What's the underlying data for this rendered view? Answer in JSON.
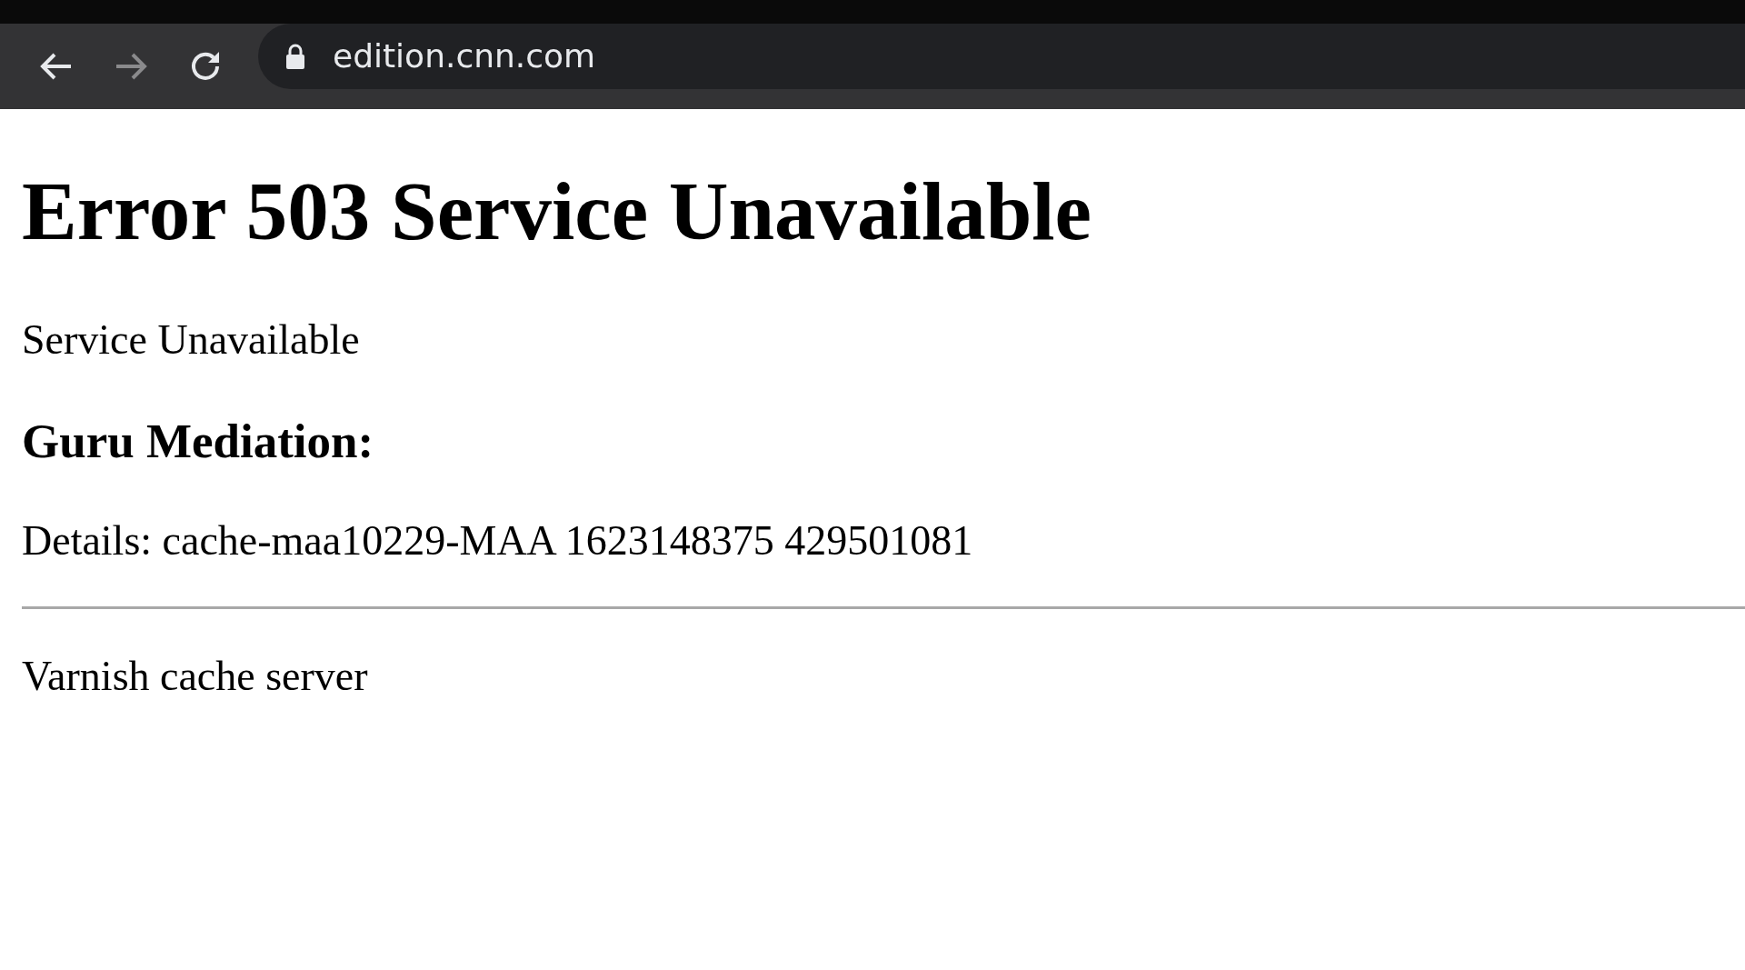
{
  "browser": {
    "nav_buttons": [
      {
        "kind": "back",
        "disabled": false
      },
      {
        "kind": "forward",
        "disabled": true
      },
      {
        "kind": "reload",
        "disabled": false
      }
    ],
    "url": "edition.cnn.com"
  },
  "page": {
    "title": "Error 503 Service Unavailable",
    "message": "Service Unavailable",
    "subheading": "Guru Mediation:",
    "details": "Details: cache-maa10229-MAA 1623148375 429501081",
    "footer": "Varnish cache server"
  }
}
